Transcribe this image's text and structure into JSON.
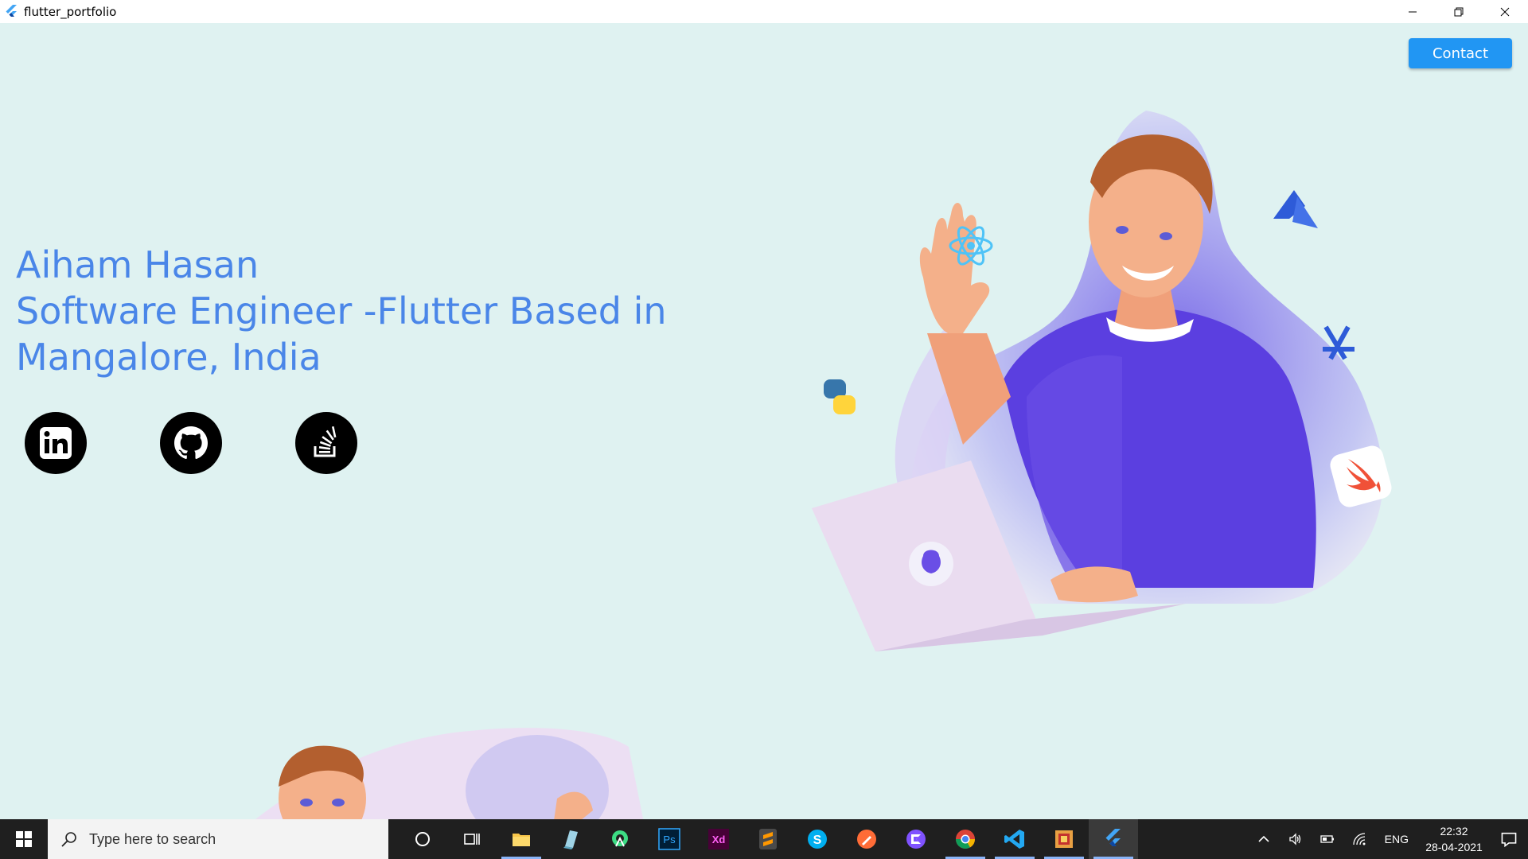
{
  "window": {
    "title": "flutter_portfolio"
  },
  "header": {
    "contact_label": "Contact"
  },
  "hero": {
    "line1": "Aiham Hasan",
    "line2": "Software Engineer -Flutter Based in",
    "line3": "Mangalore, India"
  },
  "social": [
    "linkedin-icon",
    "github-icon",
    "stackoverflow-icon"
  ],
  "taskbar": {
    "search_placeholder": "Type here to search",
    "apps": [
      "cortana",
      "task-view",
      "file-explorer",
      "notepad",
      "android-studio",
      "photoshop",
      "adobe-xd",
      "sublime-text",
      "skype",
      "postman",
      "vscode-insiders",
      "chrome",
      "vscode",
      "office",
      "flutter"
    ],
    "lang": "ENG",
    "time": "22:32",
    "date": "28-04-2021"
  },
  "colors": {
    "accent": "#4a86e8",
    "button": "#2196f3",
    "background": "#dff2f1"
  }
}
